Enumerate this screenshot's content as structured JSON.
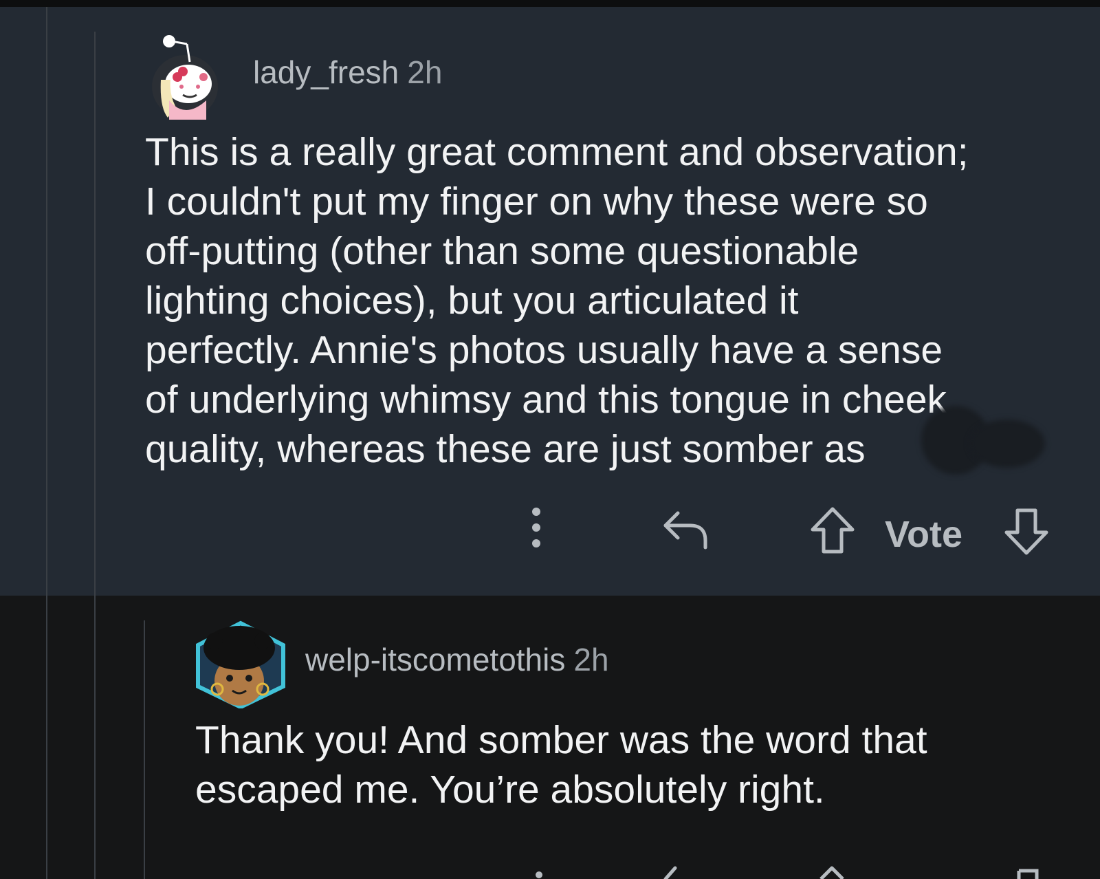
{
  "comments": [
    {
      "author": "lady_fresh",
      "time": "2h",
      "lines": [
        "This is a really great comment and observation;",
        "I couldn't put my finger on why these were so",
        "off-putting (other than some questionable",
        "lighting choices), but you articulated it",
        "perfectly. Annie's photos usually have a sense",
        "of underlying whimsy and this tongue in cheek",
        "quality, whereas these are just somber as"
      ],
      "actions": {
        "more_icon": "vertical-dots-icon",
        "reply_icon": "reply-arrow-icon",
        "upvote_icon": "upvote-arrow-icon",
        "vote_label": "Vote",
        "downvote_icon": "downvote-arrow-icon"
      }
    },
    {
      "author": "welp-itscometothis",
      "time": "2h",
      "lines": [
        "Thank you! And somber was the word that",
        "escaped me. You’re absolutely right."
      ]
    }
  ],
  "colors": {
    "parent_bg": "#232a33",
    "reply_bg": "#151617",
    "text": "#f2f3f4",
    "meta_text": "#b7bcc1"
  }
}
